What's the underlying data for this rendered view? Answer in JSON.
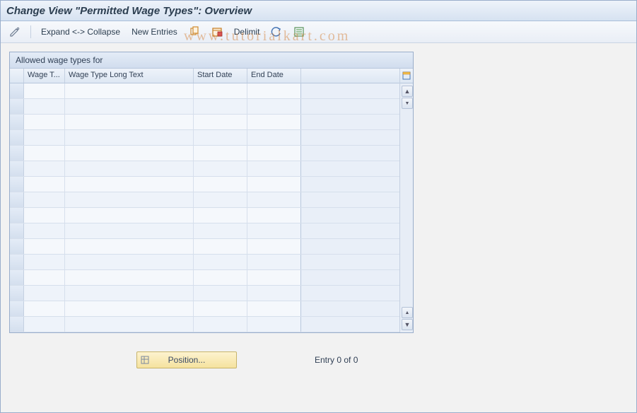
{
  "title": "Change View \"Permitted Wage Types\": Overview",
  "toolbar": {
    "expand_collapse": "Expand <-> Collapse",
    "new_entries": "New Entries",
    "delimit": "Delimit"
  },
  "panel": {
    "title": "Allowed wage types for"
  },
  "columns": {
    "wage_type": "Wage T...",
    "wage_type_long": "Wage Type Long Text",
    "start_date": "Start Date",
    "end_date": "End Date"
  },
  "rows": [
    {},
    {},
    {},
    {},
    {},
    {},
    {},
    {},
    {},
    {},
    {},
    {},
    {},
    {},
    {},
    {}
  ],
  "position_button": "Position...",
  "entry_text": "Entry 0 of 0",
  "watermark": "www.tutorialkart.com"
}
